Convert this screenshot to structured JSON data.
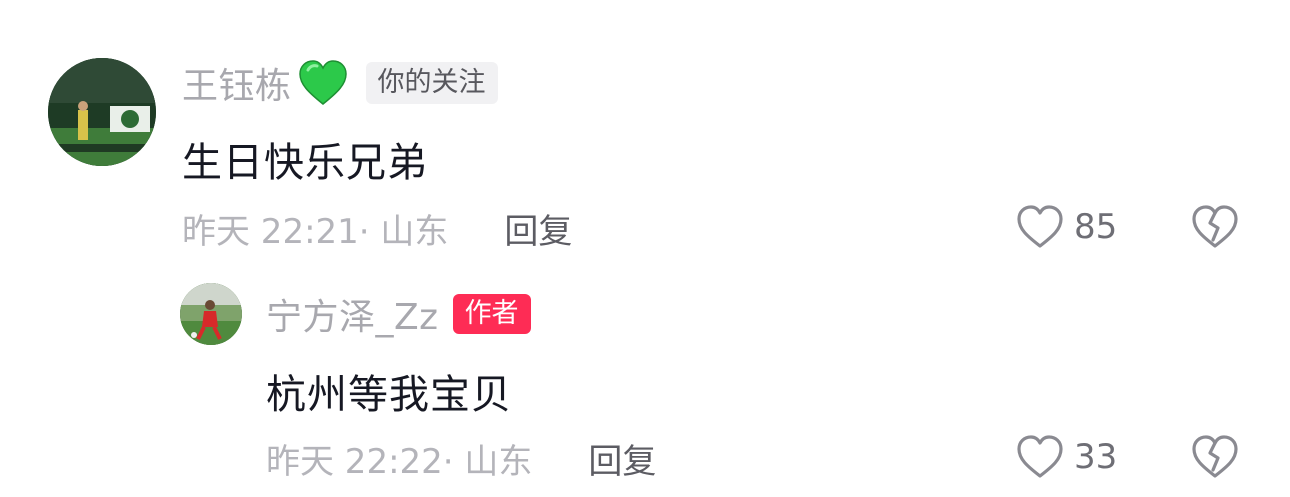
{
  "comments": [
    {
      "username": "王钰栋",
      "badge": "你的关注",
      "text": "生日快乐兄弟",
      "meta": "昨天 22:21· 山东",
      "reply_label": "回复",
      "likes": "85",
      "heart_emoji": "green-heart-icon"
    },
    {
      "username": "宁方泽_Zz",
      "badge": "作者",
      "text": "杭州等我宝贝",
      "meta": "昨天 22:22· 山东",
      "reply_label": "回复",
      "likes": "33"
    }
  ],
  "colors": {
    "author_badge": "#fe2c55",
    "username": "#a8a8ae",
    "comment_text": "#161823",
    "meta": "#b4b4ba"
  }
}
